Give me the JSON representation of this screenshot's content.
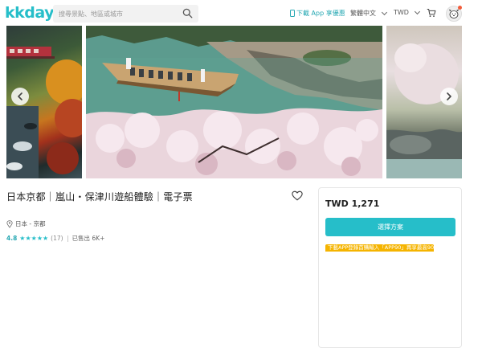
{
  "header": {
    "logo": "kkday",
    "search_placeholder": "搜尋景點、地區或城市",
    "app_download": "下載 App 享優惠",
    "language": "繁體中文",
    "currency": "TWD"
  },
  "product": {
    "title": "日本京都｜嵐山・保津川遊船體驗｜電子票",
    "location": "日本 - 京都",
    "rating": "4.8",
    "stars": "★★★★★",
    "review_count": "(17)",
    "sold": "已售出 6K+"
  },
  "booking": {
    "price": "TWD 1,271",
    "select_button": "選擇方案",
    "promo_text": "下載APP登錄首購輸入「APP90」再享最高90"
  },
  "colors": {
    "brand": "#26bec9",
    "promo": "#f5b400",
    "text": "#212121"
  }
}
